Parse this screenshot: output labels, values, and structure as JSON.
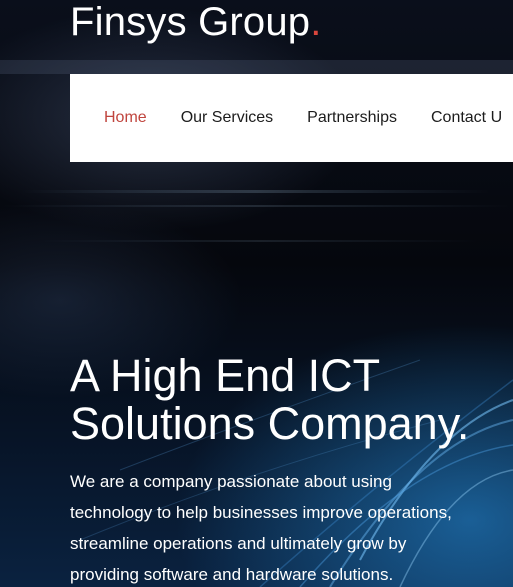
{
  "brand": {
    "name": "Finsys Group",
    "dot": ".",
    "accent_color": "#d9463d"
  },
  "nav": {
    "items": [
      {
        "label": "Home",
        "active": true
      },
      {
        "label": "Our Services",
        "active": false
      },
      {
        "label": "Partnerships",
        "active": false
      },
      {
        "label": "Contact U",
        "active": false
      }
    ]
  },
  "hero": {
    "title_line1": "A High End ICT",
    "title_line2": "Solutions Company.",
    "text_lines": [
      "We are a company passionate about using",
      "technology to help businesses improve operations,",
      "streamline operations and ultimately grow by",
      "providing software and hardware solutions."
    ]
  }
}
